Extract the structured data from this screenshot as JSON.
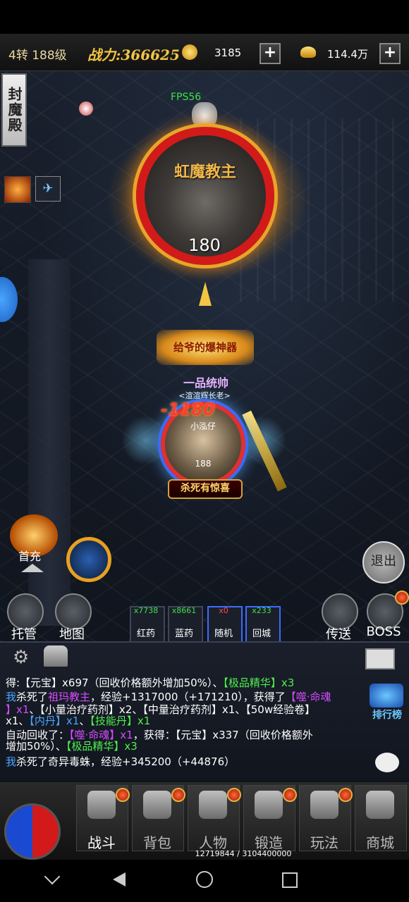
{
  "hud": {
    "level": "4转 188级",
    "power_label": "战力:366625",
    "gold_coins": "3185",
    "ingots": "114.4万",
    "plus": "+"
  },
  "fps": "FPS56",
  "side_banner": "封魔殿",
  "boss": {
    "name": "虹魔教主",
    "level": "180"
  },
  "player": {
    "title_banner": "给爷的爆神器",
    "rank_title": "一品统帅",
    "guild": "<渲渲辉长老>",
    "damage": "-1180",
    "name": "小泓仔",
    "level": "188",
    "kill_banner": "杀死有惊喜"
  },
  "left_buttons": {
    "gift": "首充",
    "auto": "托管",
    "map": "地图"
  },
  "right_buttons": {
    "exit": "退出",
    "teleport": "传送",
    "boss": "BOSS"
  },
  "potions": [
    {
      "label": "红药",
      "count": "x7738"
    },
    {
      "label": "蓝药",
      "count": "x8661"
    },
    {
      "label": "随机",
      "count": "x0"
    },
    {
      "label": "回城",
      "count": "x233"
    }
  ],
  "chat": {
    "leaderboard": "排行榜",
    "lines": [
      {
        "a": "得:【元宝】x697（回收价格额外增加50%）、",
        "b": "【极品精华】x3"
      },
      {
        "a": "我",
        "b": "杀死了",
        "c": "祖玛教主",
        "d": "，经验+1317000（+171210），获得了",
        "e": "【噬·命魂"
      },
      {
        "a": "】x1",
        "b": "、【小量治疗药剂】x2、【中量治疗药剂】x1、【50w经验卷】"
      },
      {
        "a": "x1、",
        "b": "【内丹】x1",
        "c": "、",
        "d": "【技能丹】x1"
      },
      {
        "a": "自动回收了：",
        "b": "【噬·命魂】x1",
        "c": "，获得：【元宝】x337（回收价格额外"
      },
      {
        "a": "增加50%）、",
        "b": "【极品精华】x3"
      },
      {
        "a": "我",
        "b": "杀死了奇异毒蛛，经验+345200（+44876）"
      }
    ]
  },
  "nav": [
    {
      "label": "战斗",
      "active": true
    },
    {
      "label": "背包",
      "active": false
    },
    {
      "label": "人物",
      "active": false
    },
    {
      "label": "锻造",
      "active": false
    },
    {
      "label": "玩法",
      "active": false
    },
    {
      "label": "商城",
      "active": false
    }
  ],
  "exp_text": "12719844 / 3104400000"
}
